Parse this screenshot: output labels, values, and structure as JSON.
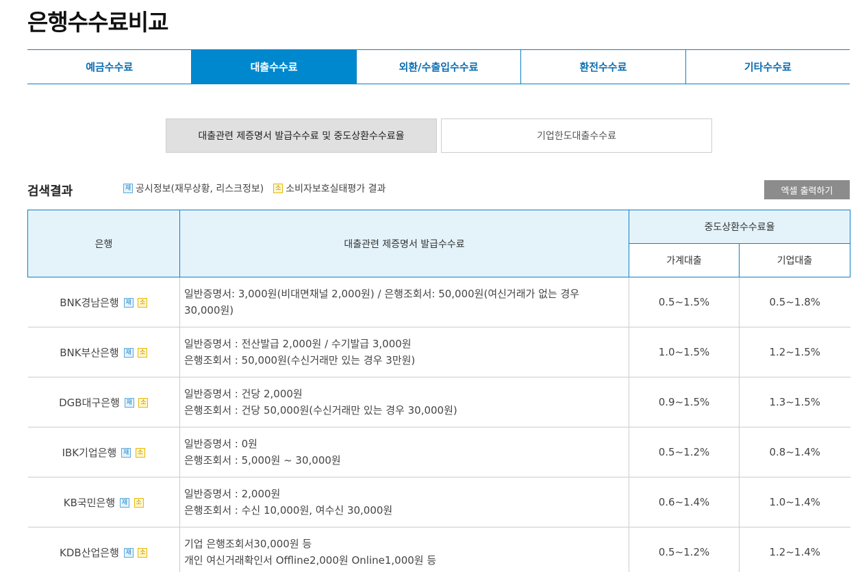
{
  "page": {
    "title": "은행수수료비교"
  },
  "main_tabs": [
    {
      "label": "예금수수료"
    },
    {
      "label": "대출수수료"
    },
    {
      "label": "외환/수출입수수료"
    },
    {
      "label": "환전수수료"
    },
    {
      "label": "기타수수료"
    }
  ],
  "sub_tabs": [
    {
      "label": "대출관련 제증명서 발급수수료 및 중도상환수수료율"
    },
    {
      "label": "기업한도대출수수료"
    }
  ],
  "results": {
    "title": "검색결과",
    "legend_jae_badge": "재",
    "legend_jae_label": "공시정보(재무상황, 리스크정보)",
    "legend_so_badge": "소",
    "legend_so_label": "소비자보호실태평가 결과",
    "excel_button": "엑셀 출력하기"
  },
  "table": {
    "headers": {
      "bank": "은행",
      "fee": "대출관련 제증명서 발급수수료",
      "rate": "중도상환수수료율",
      "household": "가계대출",
      "corporate": "기업대출"
    },
    "badges": {
      "jae": "재",
      "so": "소"
    },
    "rows": [
      {
        "bank": "BNK경남은행",
        "fee_line1": "일반증명서: 3,000원(비대면채널 2,000원) / 은행조회서: 50,000원(여신거래가 없는 경우",
        "fee_line2": "30,000원)",
        "household": "0.5~1.5%",
        "corporate": "0.5~1.8%"
      },
      {
        "bank": "BNK부산은행",
        "fee_line1": "일반증명서 : 전산발급 2,000원 / 수기발급 3,000원",
        "fee_line2": "은행조회서 : 50,000원(수신거래만 있는 경우 3만원)",
        "household": "1.0~1.5%",
        "corporate": "1.2~1.5%"
      },
      {
        "bank": "DGB대구은행",
        "fee_line1": "일반증명서 : 건당 2,000원",
        "fee_line2": "은행조회서 : 건당 50,000원(수신거래만 있는 경우 30,000원)",
        "household": "0.9~1.5%",
        "corporate": "1.3~1.5%"
      },
      {
        "bank": "IBK기업은행",
        "fee_line1": "일반증명서 : 0원",
        "fee_line2": "은행조회서 : 5,000원 ~ 30,000원",
        "household": "0.5~1.2%",
        "corporate": "0.8~1.4%"
      },
      {
        "bank": "KB국민은행",
        "fee_line1": "일반증명서 : 2,000원",
        "fee_line2": "은행조회서 : 수신 10,000원, 여수신 30,000원",
        "household": "0.6~1.4%",
        "corporate": "1.0~1.4%"
      },
      {
        "bank": "KDB산업은행",
        "fee_line1": "기업 은행조회서30,000원 등",
        "fee_line2": "개인 여신거래확인서 Offline2,000원 Online1,000원 등",
        "household": "0.5~1.2%",
        "corporate": "1.2~1.4%"
      }
    ]
  },
  "colors": {
    "accent": "#0088cf",
    "header_bg": "#e4f3fa",
    "excel_button": "#8c8c8c"
  }
}
